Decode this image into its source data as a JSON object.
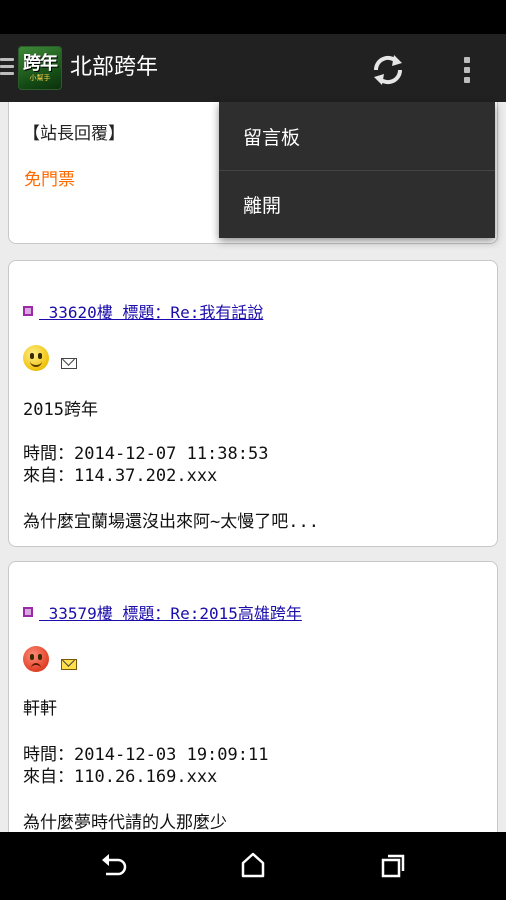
{
  "app": {
    "title": "北部跨年",
    "logo_text": "跨年",
    "logo_subtext": "小幫手"
  },
  "menu": {
    "items": [
      {
        "label": "留言板"
      },
      {
        "label": "離開"
      }
    ]
  },
  "card0": {
    "reply_label": "【站長回覆】",
    "free_ticket": "免門票"
  },
  "posts": [
    {
      "header": " 33620樓 標題：Re:我有話說",
      "name": "2015跨年",
      "time": "時間：2014-12-07 11:38:53",
      "from": "來自：114.37.202.xxx",
      "message": "為什麼宜蘭場還沒出來阿~太慢了吧...",
      "emoticon": "smile-icon"
    },
    {
      "header": " 33579樓 標題：Re:2015高雄跨年",
      "name": "軒軒",
      "time": "時間：2014-12-03 19:09:11",
      "from": "來自：110.26.169.xxx",
      "message": "為什麼夢時代請的人那麼少",
      "emoticon": "angry-icon"
    }
  ],
  "colors": {
    "action_bar": "#212121",
    "link": "#1a0dab",
    "accent": "#ff6a00",
    "dropdown": "#2e2e2e"
  }
}
